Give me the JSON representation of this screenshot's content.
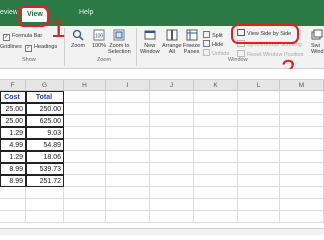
{
  "ribbon_tabs": {
    "review": "eview",
    "view": "View",
    "help": "Help"
  },
  "show_group": {
    "formula_bar": "Formula Bar",
    "gridlines": "Gridlines",
    "headings": "Headings",
    "label": "Show"
  },
  "zoom_group": {
    "zoom": "Zoom",
    "zoom100": "100%",
    "zoom_to_selection_l1": "Zoom to",
    "zoom_to_selection_l2": "Selection",
    "label": "Zoom"
  },
  "window_group": {
    "new_window_l1": "New",
    "new_window_l2": "Window",
    "arrange_all_l1": "Arrange",
    "arrange_all_l2": "All",
    "freeze_panes_l1": "Freeze",
    "freeze_panes_l2": "Panes",
    "split": "Split",
    "hide": "Hide",
    "unhide": "Unhide",
    "view_side_by_side": "View Side by Side",
    "synchronous_scrolling": "Synchronous Scrolling",
    "reset_window_position": "Reset Window Position",
    "switch_windows_l1": "Swi",
    "switch_windows_l2": "Wind",
    "label": "Window"
  },
  "annotations": {
    "step1": "1",
    "step2": "2"
  },
  "columns": [
    "F",
    "G",
    "H",
    "I",
    "J",
    "K",
    "L",
    "M"
  ],
  "table": {
    "header_f": "Cost",
    "header_g": "Total",
    "rows": [
      {
        "f": "25.00",
        "g": "250.00"
      },
      {
        "f": "25.00",
        "g": "625.00"
      },
      {
        "f": "1.29",
        "g": "9.03"
      },
      {
        "f": "4.99",
        "g": "54.89"
      },
      {
        "f": "1.29",
        "g": "18.06"
      },
      {
        "f": "8.99",
        "g": "539.73"
      },
      {
        "f": "8.99",
        "g": "251.72"
      }
    ]
  },
  "colors": {
    "ribbon_green": "#2b7a45",
    "annotation_red": "#e31e24",
    "header_blue": "#1f3fc4"
  }
}
